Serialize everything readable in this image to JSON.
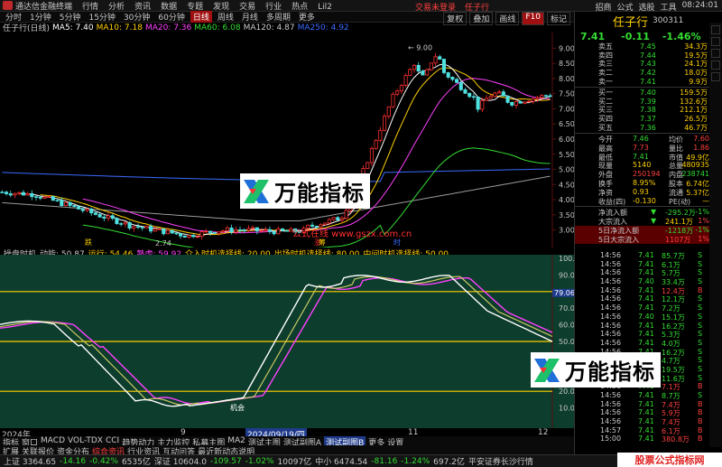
{
  "titlebar": {
    "app": "通达信金融终端",
    "menu": [
      "行情",
      "分析",
      "资讯",
      "数据",
      "专题",
      "发现",
      "交易",
      "行业",
      "热点",
      "Lil2"
    ],
    "center": [
      "交易未登录",
      "任子行"
    ],
    "time": "08:24:01",
    "right": [
      "招商",
      "公式",
      "选股",
      "工具"
    ]
  },
  "toolbar": {
    "periods": [
      "分时",
      "1分钟",
      "5分钟",
      "15分钟",
      "30分钟",
      "60分钟",
      "日线",
      "周线",
      "月线",
      "多周期",
      "更多"
    ],
    "active": "日线",
    "right": [
      "复权",
      "叠加",
      "画线",
      "F10",
      "标记"
    ]
  },
  "stock": {
    "name": "任子行",
    "name_suffix": "任子行(日线)",
    "code": "300311",
    "ma_labels": [
      {
        "text": "MA5: 7.40",
        "color": "#ffffff"
      },
      {
        "text": "MA10: 7.18",
        "color": "#ffd000"
      },
      {
        "text": "MA20: 7.36",
        "color": "#ff40ff"
      },
      {
        "text": "MA60: 6.08",
        "color": "#33dd33"
      },
      {
        "text": "MA120: 4.87",
        "color": "#c8c8c8"
      },
      {
        "text": "MA250: 4.92",
        "color": "#3a6bff"
      }
    ],
    "price": "7.41",
    "change": "-0.11",
    "pct": "-1.46%"
  },
  "main_chart": {
    "peak_label": "9.00",
    "low_label": "2.74",
    "y_ticks": [
      "9.00",
      "8.50",
      "8.00",
      "7.50",
      "7.00",
      "6.50",
      "6.00",
      "5.50",
      "5.00",
      "4.50",
      "4.00",
      "3.50",
      "3.00"
    ],
    "signals": [
      "跌",
      "涨",
      "筹",
      "时"
    ],
    "url_text": "公式在线 www.gszx.com.cn"
  },
  "oscillator": {
    "header": [
      {
        "text": "操盘时机",
        "color": "#c8c8c8"
      },
      {
        "text": "动能: 50.87",
        "color": "#c8c8c8"
      },
      {
        "text": "运行: 54.46",
        "color": "#ffd000"
      },
      {
        "text": "熟虑: 59.92",
        "color": "#ff40ff"
      },
      {
        "text": "介入时机选择线: 20.00",
        "color": "#ffd000"
      },
      {
        "text": "出场时机选择线: 80.00",
        "color": "#ffd000"
      },
      {
        "text": "中间时机选择线: 50.00",
        "color": "#ffd000"
      }
    ],
    "marker": "机会",
    "value_box": "79.06",
    "y_ticks": [
      "100.00",
      "90.00",
      "80.00",
      "70.00",
      "60.00",
      "50.00",
      "40.00",
      "30.00",
      "20.00",
      "10.00"
    ]
  },
  "date_axis": [
    "2024年",
    "9",
    "2024/09/19/四",
    "11",
    "12"
  ],
  "bottom_tabs": [
    "指标",
    "窗口",
    "MACD",
    "VOL-TDX",
    "CCI",
    "趋势动力",
    "主力监控",
    "私募主图",
    "MA2",
    "测试主图",
    "测试副图A",
    "测试副图B",
    "更多",
    "设置"
  ],
  "bottom_tabs_hl": "测试副图B",
  "link_tabs": [
    "扩展",
    "关联报价",
    "资金分布",
    "综合资讯",
    "行业资讯",
    "互动问答",
    "最近新动态说明"
  ],
  "link_tabs_em": "综合资讯",
  "status": {
    "items": [
      {
        "text": "上证 3364.65",
        "color": "#c8c8c8"
      },
      {
        "text": "-14.16",
        "color": "#33dd33"
      },
      {
        "text": "-0.42%",
        "color": "#33dd33"
      },
      {
        "text": "6535亿",
        "color": "#c8c8c8"
      },
      {
        "text": "深证 10604.0",
        "color": "#c8c8c8"
      },
      {
        "text": "-109.57",
        "color": "#33dd33"
      },
      {
        "text": "-1.02%",
        "color": "#33dd33"
      },
      {
        "text": "10097亿",
        "color": "#c8c8c8"
      },
      {
        "text": "中小 6474.54",
        "color": "#c8c8c8"
      },
      {
        "text": "-81.16",
        "color": "#33dd33"
      },
      {
        "text": "-1.24%",
        "color": "#33dd33"
      },
      {
        "text": "697.2亿",
        "color": "#c8c8c8"
      },
      {
        "text": "平安证券长沙行情",
        "color": "#c8c8c8"
      }
    ],
    "badge": "股票公式指标网"
  },
  "orderbook": {
    "asks": [
      {
        "label": "卖五",
        "price": "7.45",
        "vol": "34.3万"
      },
      {
        "label": "卖四",
        "price": "7.44",
        "vol": "19.5万"
      },
      {
        "label": "卖三",
        "price": "7.43",
        "vol": "24.1万"
      },
      {
        "label": "卖二",
        "price": "7.42",
        "vol": "18.0万"
      },
      {
        "label": "卖一",
        "price": "7.41",
        "vol": "9.9万"
      }
    ],
    "bids": [
      {
        "label": "买一",
        "price": "7.40",
        "vol": "159.5万"
      },
      {
        "label": "买二",
        "price": "7.39",
        "vol": "132.6万"
      },
      {
        "label": "买三",
        "price": "7.38",
        "vol": "212.1万"
      },
      {
        "label": "买四",
        "price": "7.37",
        "vol": "26.5万"
      },
      {
        "label": "买五",
        "price": "7.36",
        "vol": "46.7万"
      }
    ]
  },
  "quote": [
    [
      {
        "t": "今开",
        "c": "w"
      },
      {
        "t": "7.46",
        "c": "g"
      },
      {
        "t": "均价",
        "c": "w"
      },
      {
        "t": "7.60",
        "c": "r"
      }
    ],
    [
      {
        "t": "最高",
        "c": "w"
      },
      {
        "t": "7.73",
        "c": "r"
      },
      {
        "t": "量比",
        "c": "w"
      },
      {
        "t": "1.86",
        "c": "r"
      }
    ],
    [
      {
        "t": "最低",
        "c": "w"
      },
      {
        "t": "7.41",
        "c": "g"
      },
      {
        "t": "市值",
        "c": "w"
      },
      {
        "t": "49.9亿",
        "c": "y"
      }
    ],
    [
      {
        "t": "现量",
        "c": "w"
      },
      {
        "t": "5140",
        "c": "y"
      },
      {
        "t": "总量",
        "c": "w"
      },
      {
        "t": "480935",
        "c": "y"
      }
    ],
    [
      {
        "t": "外盘",
        "c": "w"
      },
      {
        "t": "250194",
        "c": "r"
      },
      {
        "t": "内盘",
        "c": "w"
      },
      {
        "t": "238741",
        "c": "g"
      }
    ],
    [
      {
        "t": "换手",
        "c": "w"
      },
      {
        "t": "8.95%",
        "c": "y"
      },
      {
        "t": "股本",
        "c": "w"
      },
      {
        "t": "6.74亿",
        "c": "y"
      }
    ],
    [
      {
        "t": "净资",
        "c": "w"
      },
      {
        "t": "0.93",
        "c": "y"
      },
      {
        "t": "流通",
        "c": "w"
      },
      {
        "t": "5.37亿",
        "c": "y"
      }
    ],
    [
      {
        "t": "收益(四)",
        "c": "w"
      },
      {
        "t": "-0.130",
        "c": "y"
      },
      {
        "t": "PE(动)",
        "c": "w"
      },
      {
        "t": "—",
        "c": "y"
      }
    ]
  ],
  "flow": [
    [
      {
        "t": "净流入额",
        "c": "w"
      },
      {
        "t": "▼",
        "c": "g"
      },
      {
        "t": "-295.2万",
        "c": "g"
      },
      {
        "t": "-1%",
        "c": "g"
      }
    ],
    [
      {
        "t": "大宗流入",
        "c": "w"
      },
      {
        "t": "▼",
        "c": "g"
      },
      {
        "t": "241.1万",
        "c": "y"
      },
      {
        "t": "1%",
        "c": "r"
      }
    ],
    [
      {
        "t": "5日净流入额",
        "c": "w"
      },
      {
        "t": "",
        "c": "g"
      },
      {
        "t": "-1218万",
        "c": "g"
      },
      {
        "t": "-1%",
        "c": "g"
      }
    ],
    [
      {
        "t": "5日大宗流入",
        "c": "w"
      },
      {
        "t": "",
        "c": "g"
      },
      {
        "t": "1107万",
        "c": "r"
      },
      {
        "t": "1%",
        "c": "r"
      }
    ]
  ],
  "trades": [
    [
      "14:56",
      "7.41",
      "85.7万",
      "S"
    ],
    [
      "14:56",
      "7.41",
      "6.1万",
      "S"
    ],
    [
      "14:56",
      "7.41",
      "5.7万",
      "S"
    ],
    [
      "14:56",
      "7.40",
      "33.4万",
      "S"
    ],
    [
      "14:56",
      "7.41",
      "12.4万",
      "B"
    ],
    [
      "14:56",
      "7.41",
      "12.1万",
      "S"
    ],
    [
      "14:56",
      "7.41",
      "7.2万",
      "S"
    ],
    [
      "14:56",
      "7.40",
      "15.1万",
      "S"
    ],
    [
      "14:56",
      "7.41",
      "16.2万",
      "S"
    ],
    [
      "14:56",
      "7.41",
      "5.3万",
      "S"
    ],
    [
      "14:56",
      "7.41",
      "4.0万",
      "S"
    ],
    [
      "14:56",
      "7.41",
      "16.2万",
      "S"
    ],
    [
      "14:56",
      "7.41",
      "4.7万",
      "S"
    ],
    [
      "14:56",
      "7.41",
      "19.5万",
      "S"
    ],
    [
      "14:56",
      "7.41",
      "11.6万",
      "S"
    ],
    [
      "14:56",
      "7.41",
      "7.1万",
      "B"
    ],
    [
      "14:56",
      "7.41",
      "8.7万",
      "S"
    ],
    [
      "14:56",
      "7.41",
      "7.4万",
      "B"
    ],
    [
      "14:56",
      "7.41",
      "5.9万",
      "B"
    ],
    [
      "14:56",
      "7.41",
      "7.4万",
      "B"
    ],
    [
      "14:57",
      "7.41",
      "6.1万",
      "B"
    ],
    [
      "15:00",
      "7.41",
      "380.8万",
      "B"
    ]
  ],
  "watermark": "万能指标"
}
